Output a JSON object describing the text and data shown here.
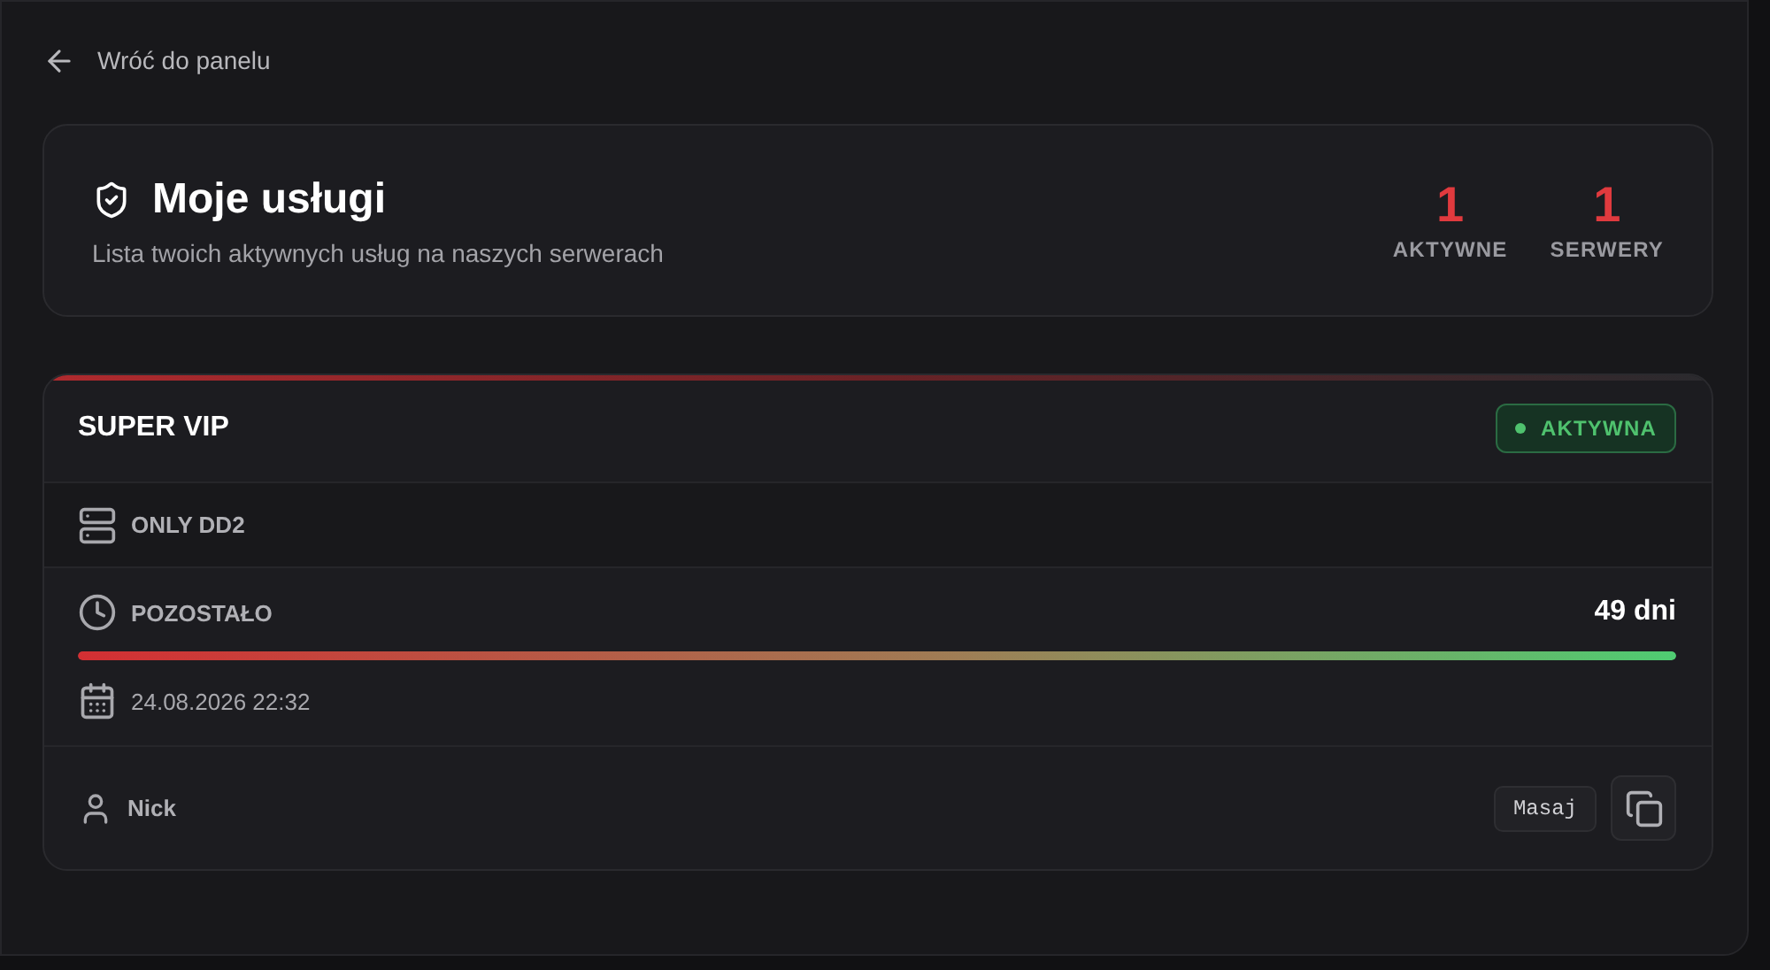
{
  "back_link": {
    "label": "Wróć do panelu"
  },
  "header": {
    "title": "Moje usługi",
    "subtitle": "Lista twoich aktywnych usług na naszych serwerach",
    "stats": [
      {
        "value": "1",
        "label": "AKTYWNE"
      },
      {
        "value": "1",
        "label": "SERWERY"
      }
    ]
  },
  "services": [
    {
      "name": "SUPER VIP",
      "status": {
        "label": "AKTYWNA",
        "active": true
      },
      "server": "ONLY DD2",
      "remaining_label": "POZOSTAŁO",
      "remaining_value": "49 dni",
      "level": 1,
      "expires": "24.08.2026 22:32",
      "nick_label": "Nick",
      "nick_value": "Masaj"
    }
  ]
}
